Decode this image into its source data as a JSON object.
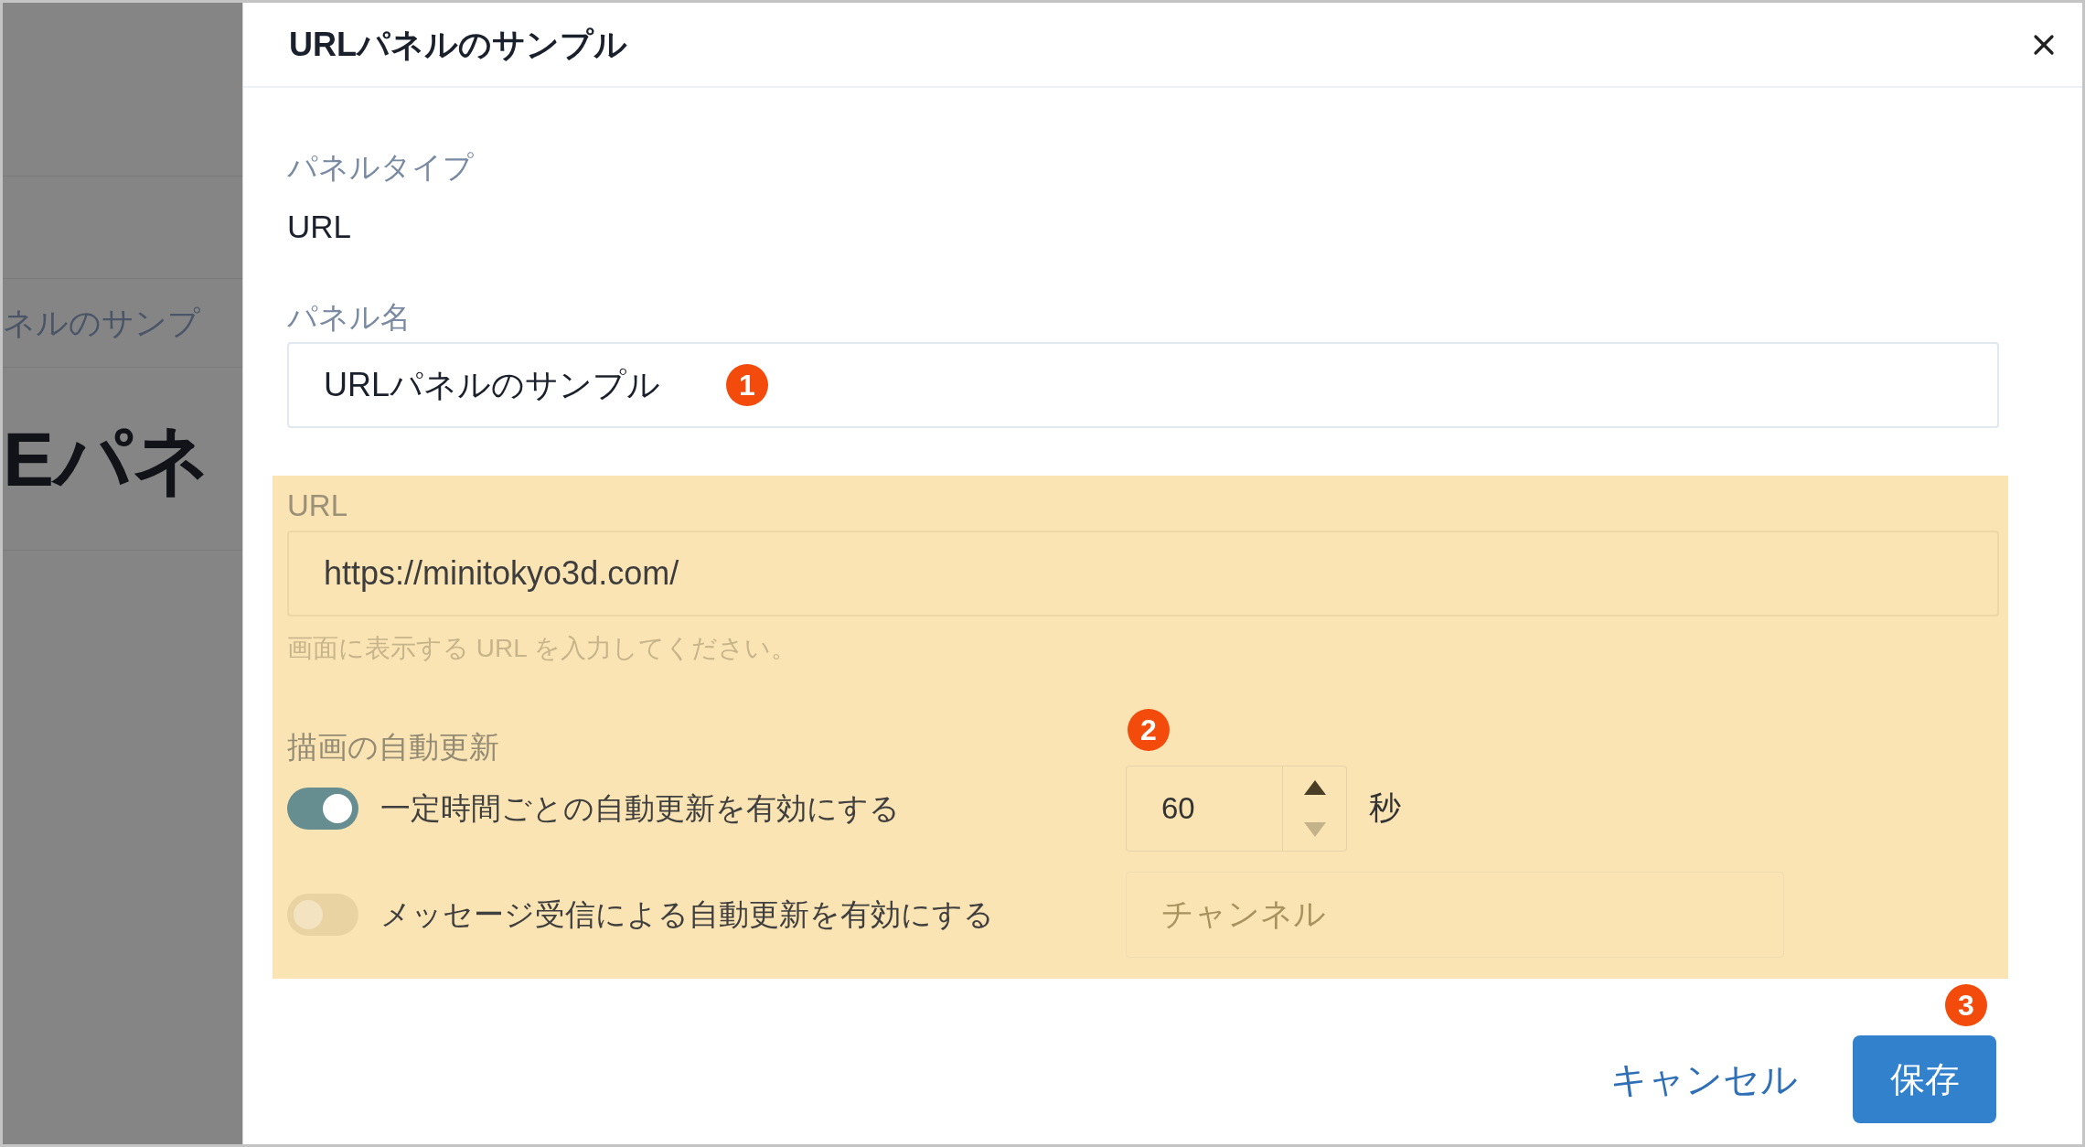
{
  "background": {
    "breadcrumb": "ネルのサンプ",
    "heading": "Eパネ"
  },
  "dialog": {
    "title": "URLパネルのサンプル",
    "panel_type": {
      "label": "パネルタイプ",
      "value": "URL"
    },
    "panel_name": {
      "label": "パネル名",
      "value": "URLパネルのサンプル",
      "marker": "1"
    },
    "url": {
      "label": "URL",
      "value": "https://minitokyo3d.com/",
      "help": "画面に表示する URL を入力してください。"
    },
    "auto_refresh": {
      "label": "描画の自動更新",
      "marker": "2",
      "options": [
        {
          "kind": "interval",
          "label": "一定時間ごとの自動更新を有効にする",
          "on": true,
          "value": "60",
          "unit": "秒"
        },
        {
          "kind": "message",
          "label": "メッセージ受信による自動更新を有効にする",
          "on": false,
          "placeholder": "チャンネル"
        }
      ]
    },
    "buttons": {
      "cancel": "キャンセル",
      "save": "保存",
      "marker": "3"
    }
  }
}
